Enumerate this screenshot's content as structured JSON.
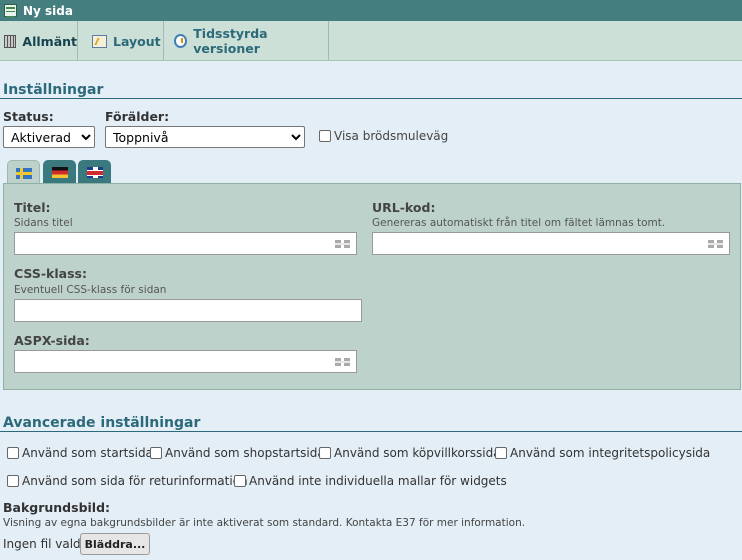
{
  "window": {
    "title": "Ny sida"
  },
  "tabs": [
    {
      "label": "Allmänt",
      "icon": "grid-icon",
      "active": true
    },
    {
      "label": "Layout",
      "icon": "layout-icon",
      "active": false
    },
    {
      "label": "Tidsstyrda versioner",
      "icon": "clock-icon",
      "active": false
    }
  ],
  "settings": {
    "heading": "Inställningar",
    "status_label": "Status:",
    "status_value": "Aktiverad",
    "parent_label": "Förälder:",
    "parent_value": "Toppnivå",
    "breadcrumb_checkbox": "Visa brödsmuleväg"
  },
  "languages": [
    {
      "name": "swedish-flag",
      "active": true
    },
    {
      "name": "german-flag",
      "active": false
    },
    {
      "name": "uk-flag",
      "active": false
    }
  ],
  "fields": {
    "title_label": "Titel:",
    "title_help": "Sidans titel",
    "url_label": "URL-kod:",
    "url_help": "Genereras automatiskt från titel om fältet lämnas tomt.",
    "css_label": "CSS-klass:",
    "css_help": "Eventuell CSS-klass för sidan",
    "aspx_label": "ASPX-sida:"
  },
  "advanced": {
    "heading": "Avancerade inställningar",
    "checkboxes": [
      "Använd som startsida",
      "Använd som shopstartsida",
      "Använd som köpvillkorssida",
      "Använd som integritetspolicysida",
      "Använd som sida för returinformation",
      "Använd inte individuella mallar för widgets"
    ]
  },
  "background": {
    "label": "Bakgrundsbild:",
    "note": "Visning av egna bakgrundsbilder är inte aktiverat som standard. Kontakta E37 för mer information.",
    "no_file": "Ingen fil vald",
    "browse_label": "Bläddra..."
  },
  "colors": {
    "titlebar": "#457e7e",
    "accent": "#2c6a7a",
    "panel": "#bdd2cb"
  }
}
